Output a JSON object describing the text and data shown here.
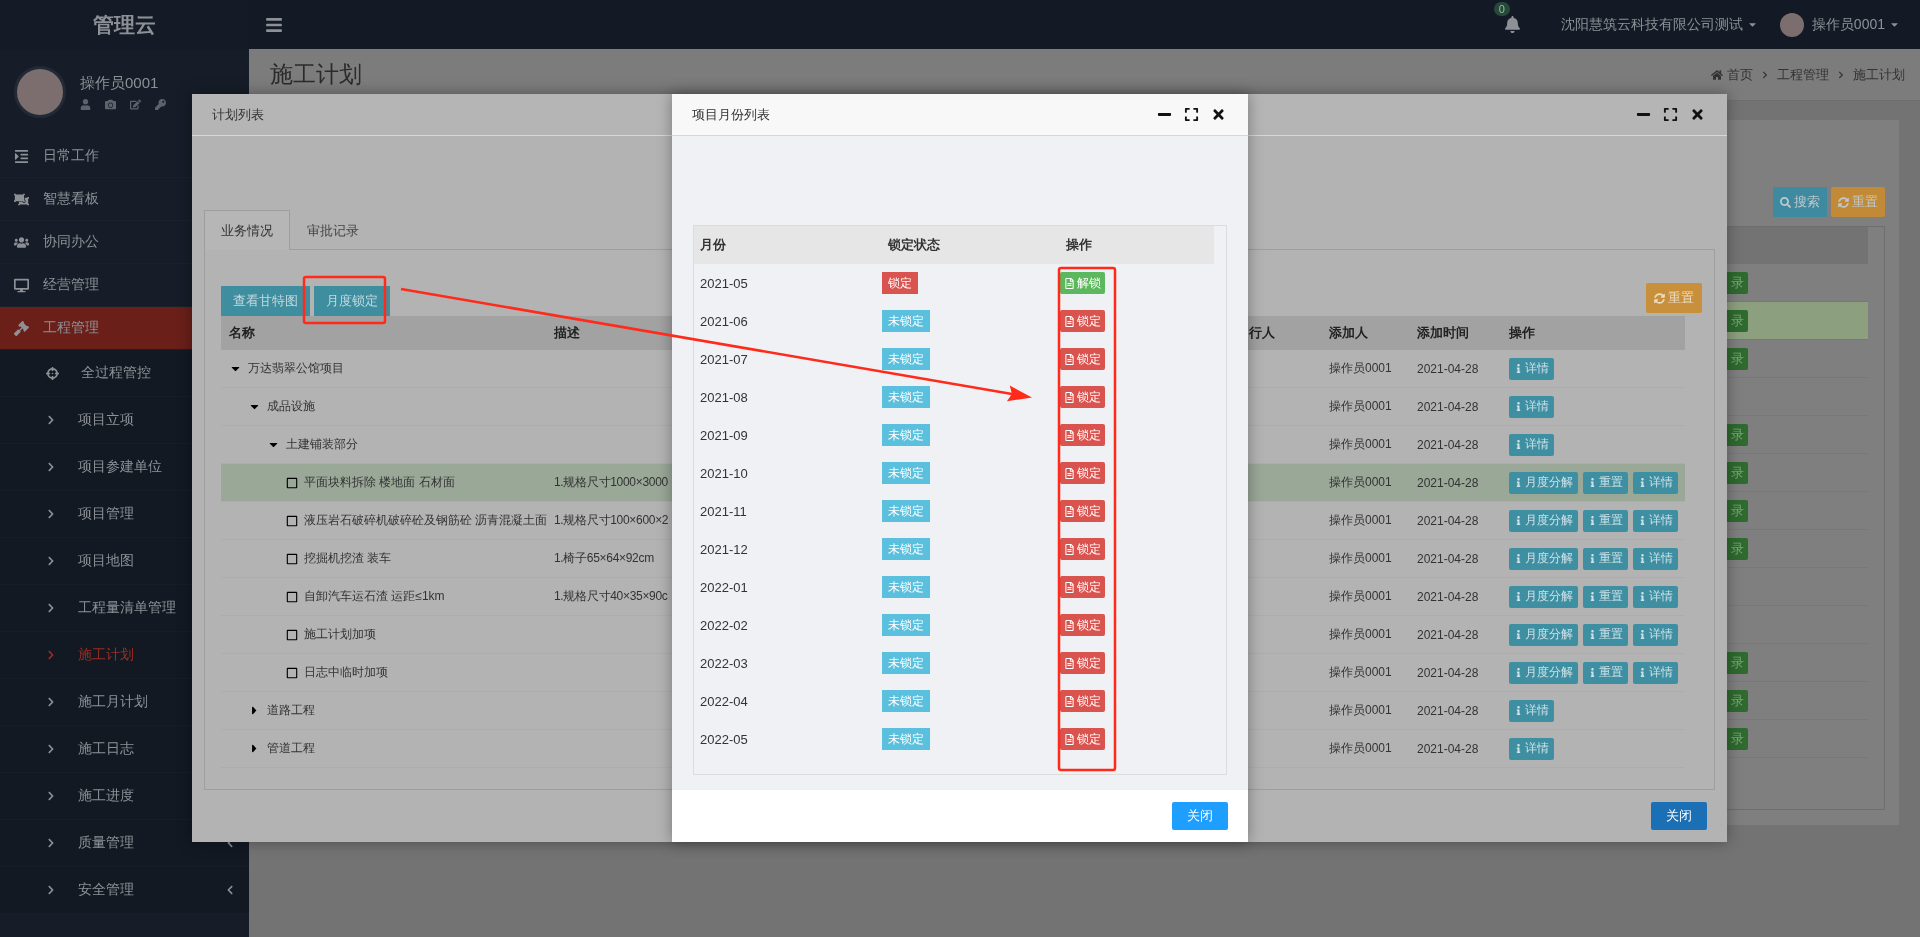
{
  "topbar": {
    "notifications": "0",
    "company": "沈阳慧筑云科技有限公司测试",
    "user": "操作员0001"
  },
  "sidebar": {
    "logo": "管理云",
    "user": "操作员0001",
    "items": [
      {
        "label": "日常工作",
        "selected": false
      },
      {
        "label": "智慧看板",
        "selected": false
      },
      {
        "label": "协同办公",
        "selected": false
      },
      {
        "label": "经营管理",
        "selected": false
      },
      {
        "label": "工程管理",
        "selected": true,
        "children": [
          {
            "label": "全过程管控",
            "kind": "icon",
            "selected": false
          },
          {
            "label": "项目立项",
            "kind": "link",
            "selected": false
          },
          {
            "label": "项目参建单位",
            "kind": "link",
            "selected": false
          },
          {
            "label": "项目管理",
            "kind": "link",
            "selected": false
          },
          {
            "label": "项目地图",
            "kind": "link",
            "selected": false
          },
          {
            "label": "工程量清单管理",
            "kind": "link",
            "selected": false
          },
          {
            "label": "施工计划",
            "kind": "link",
            "selected": true
          },
          {
            "label": "施工月计划",
            "kind": "link",
            "selected": false
          },
          {
            "label": "施工日志",
            "kind": "link",
            "selected": false
          },
          {
            "label": "施工进度",
            "kind": "link",
            "selected": false
          },
          {
            "label": "质量管理",
            "kind": "link",
            "selected": false,
            "expanded": false
          },
          {
            "label": "安全管理",
            "kind": "link",
            "selected": false,
            "expanded": false
          }
        ]
      }
    ]
  },
  "page": {
    "title": "施工计划",
    "breadcrumb": [
      "首页",
      "工程管理",
      "施工计划"
    ],
    "search_button": "搜索",
    "reset_button": "重置",
    "rows": [
      {
        "action": "录",
        "highlighted": false
      },
      {
        "action": "录",
        "highlighted": true
      },
      {
        "action": "录",
        "highlighted": false
      },
      {
        "highlighted": false
      },
      {
        "action": "录",
        "highlighted": false
      },
      {
        "action": "录",
        "highlighted": false
      },
      {
        "action": "录",
        "highlighted": false
      },
      {
        "action": "录",
        "highlighted": false
      },
      {
        "highlighted": false
      },
      {
        "highlighted": false
      },
      {
        "action": "录",
        "highlighted": false
      },
      {
        "action": "录",
        "highlighted": false
      },
      {
        "action": "录",
        "highlighted": false
      }
    ]
  },
  "plan_modal": {
    "title": "计划列表",
    "tabs": [
      {
        "label": "业务情况",
        "selected": true
      },
      {
        "label": "审批记录",
        "selected": false
      }
    ],
    "buttons": [
      "查看甘特图",
      "月度锁定"
    ],
    "reset_button": "重置",
    "columns": [
      "名称",
      "描述",
      "行人",
      "添加人",
      "添加时间",
      "操作"
    ],
    "tree": [
      {
        "name": "万达翡翠公馆项目",
        "expanded": true,
        "highlighted": false,
        "adder": "操作员0001",
        "time": "2021-04-28",
        "actions": [
          "详情"
        ],
        "children": [
          {
            "name": "成品设施",
            "expanded": true,
            "highlighted": false,
            "adder": "操作员0001",
            "time": "2021-04-28",
            "actions": [
              "详情"
            ],
            "children": [
              {
                "name": "土建铺装部分",
                "expanded": true,
                "highlighted": false,
                "adder": "操作员0001",
                "time": "2021-04-28",
                "actions": [
                  "详情"
                ],
                "children": [
                  {
                    "name": "平面块料拆除 楼地面 石材面",
                    "description": "1.规格尺寸1000×3000",
                    "highlighted": true,
                    "adder": "操作员0001",
                    "time": "2021-04-28",
                    "actions": [
                      "月度分解",
                      "重置",
                      "详情"
                    ]
                  },
                  {
                    "name": "液压岩石破碎机破碎砼及钢筋砼 沥青混凝土面",
                    "description": "1.规格尺寸100×600×2",
                    "highlighted": false,
                    "adder": "操作员0001",
                    "time": "2021-04-28",
                    "actions": [
                      "月度分解",
                      "重置",
                      "详情"
                    ]
                  },
                  {
                    "name": "挖掘机挖渣 装车",
                    "description": "1.椅子65×64×92cm",
                    "highlighted": false,
                    "adder": "操作员0001",
                    "time": "2021-04-28",
                    "actions": [
                      "月度分解",
                      "重置",
                      "详情"
                    ]
                  },
                  {
                    "name": "自卸汽车运石渣 运距≤1km",
                    "description": "1.规格尺寸40×35×90c",
                    "highlighted": false,
                    "adder": "操作员0001",
                    "time": "2021-04-28",
                    "actions": [
                      "月度分解",
                      "重置",
                      "详情"
                    ]
                  },
                  {
                    "name": "施工计划加项",
                    "highlighted": false,
                    "adder": "操作员0001",
                    "time": "2021-04-28",
                    "actions": [
                      "月度分解",
                      "重置",
                      "详情"
                    ]
                  },
                  {
                    "name": "日志中临时加项",
                    "highlighted": false,
                    "adder": "操作员0001",
                    "time": "2021-04-28",
                    "actions": [
                      "月度分解",
                      "重置",
                      "详情"
                    ]
                  }
                ]
              }
            ]
          },
          {
            "name": "道路工程",
            "expanded": false,
            "highlighted": false,
            "adder": "操作员0001",
            "time": "2021-04-28",
            "actions": [
              "详情"
            ]
          },
          {
            "name": "管道工程",
            "expanded": false,
            "highlighted": false,
            "adder": "操作员0001",
            "time": "2021-04-28",
            "actions": [
              "详情"
            ]
          }
        ]
      }
    ],
    "close_button": "关闭"
  },
  "month_modal": {
    "title": "项目月份列表",
    "columns": [
      "月份",
      "锁定状态",
      "操作"
    ],
    "months": [
      {
        "month": "2021-05",
        "status": "锁定",
        "locked": true,
        "action": "解锁"
      },
      {
        "month": "2021-06",
        "status": "未锁定",
        "locked": false,
        "action": "锁定"
      },
      {
        "month": "2021-07",
        "status": "未锁定",
        "locked": false,
        "action": "锁定"
      },
      {
        "month": "2021-08",
        "status": "未锁定",
        "locked": false,
        "action": "锁定"
      },
      {
        "month": "2021-09",
        "status": "未锁定",
        "locked": false,
        "action": "锁定"
      },
      {
        "month": "2021-10",
        "status": "未锁定",
        "locked": false,
        "action": "锁定"
      },
      {
        "month": "2021-11",
        "status": "未锁定",
        "locked": false,
        "action": "锁定"
      },
      {
        "month": "2021-12",
        "status": "未锁定",
        "locked": false,
        "action": "锁定"
      },
      {
        "month": "2022-01",
        "status": "未锁定",
        "locked": false,
        "action": "锁定"
      },
      {
        "month": "2022-02",
        "status": "未锁定",
        "locked": false,
        "action": "锁定"
      },
      {
        "month": "2022-03",
        "status": "未锁定",
        "locked": false,
        "action": "锁定"
      },
      {
        "month": "2022-04",
        "status": "未锁定",
        "locked": false,
        "action": "锁定"
      },
      {
        "month": "2022-05",
        "status": "未锁定",
        "locked": false,
        "action": "锁定"
      }
    ],
    "close_button": "关闭"
  }
}
